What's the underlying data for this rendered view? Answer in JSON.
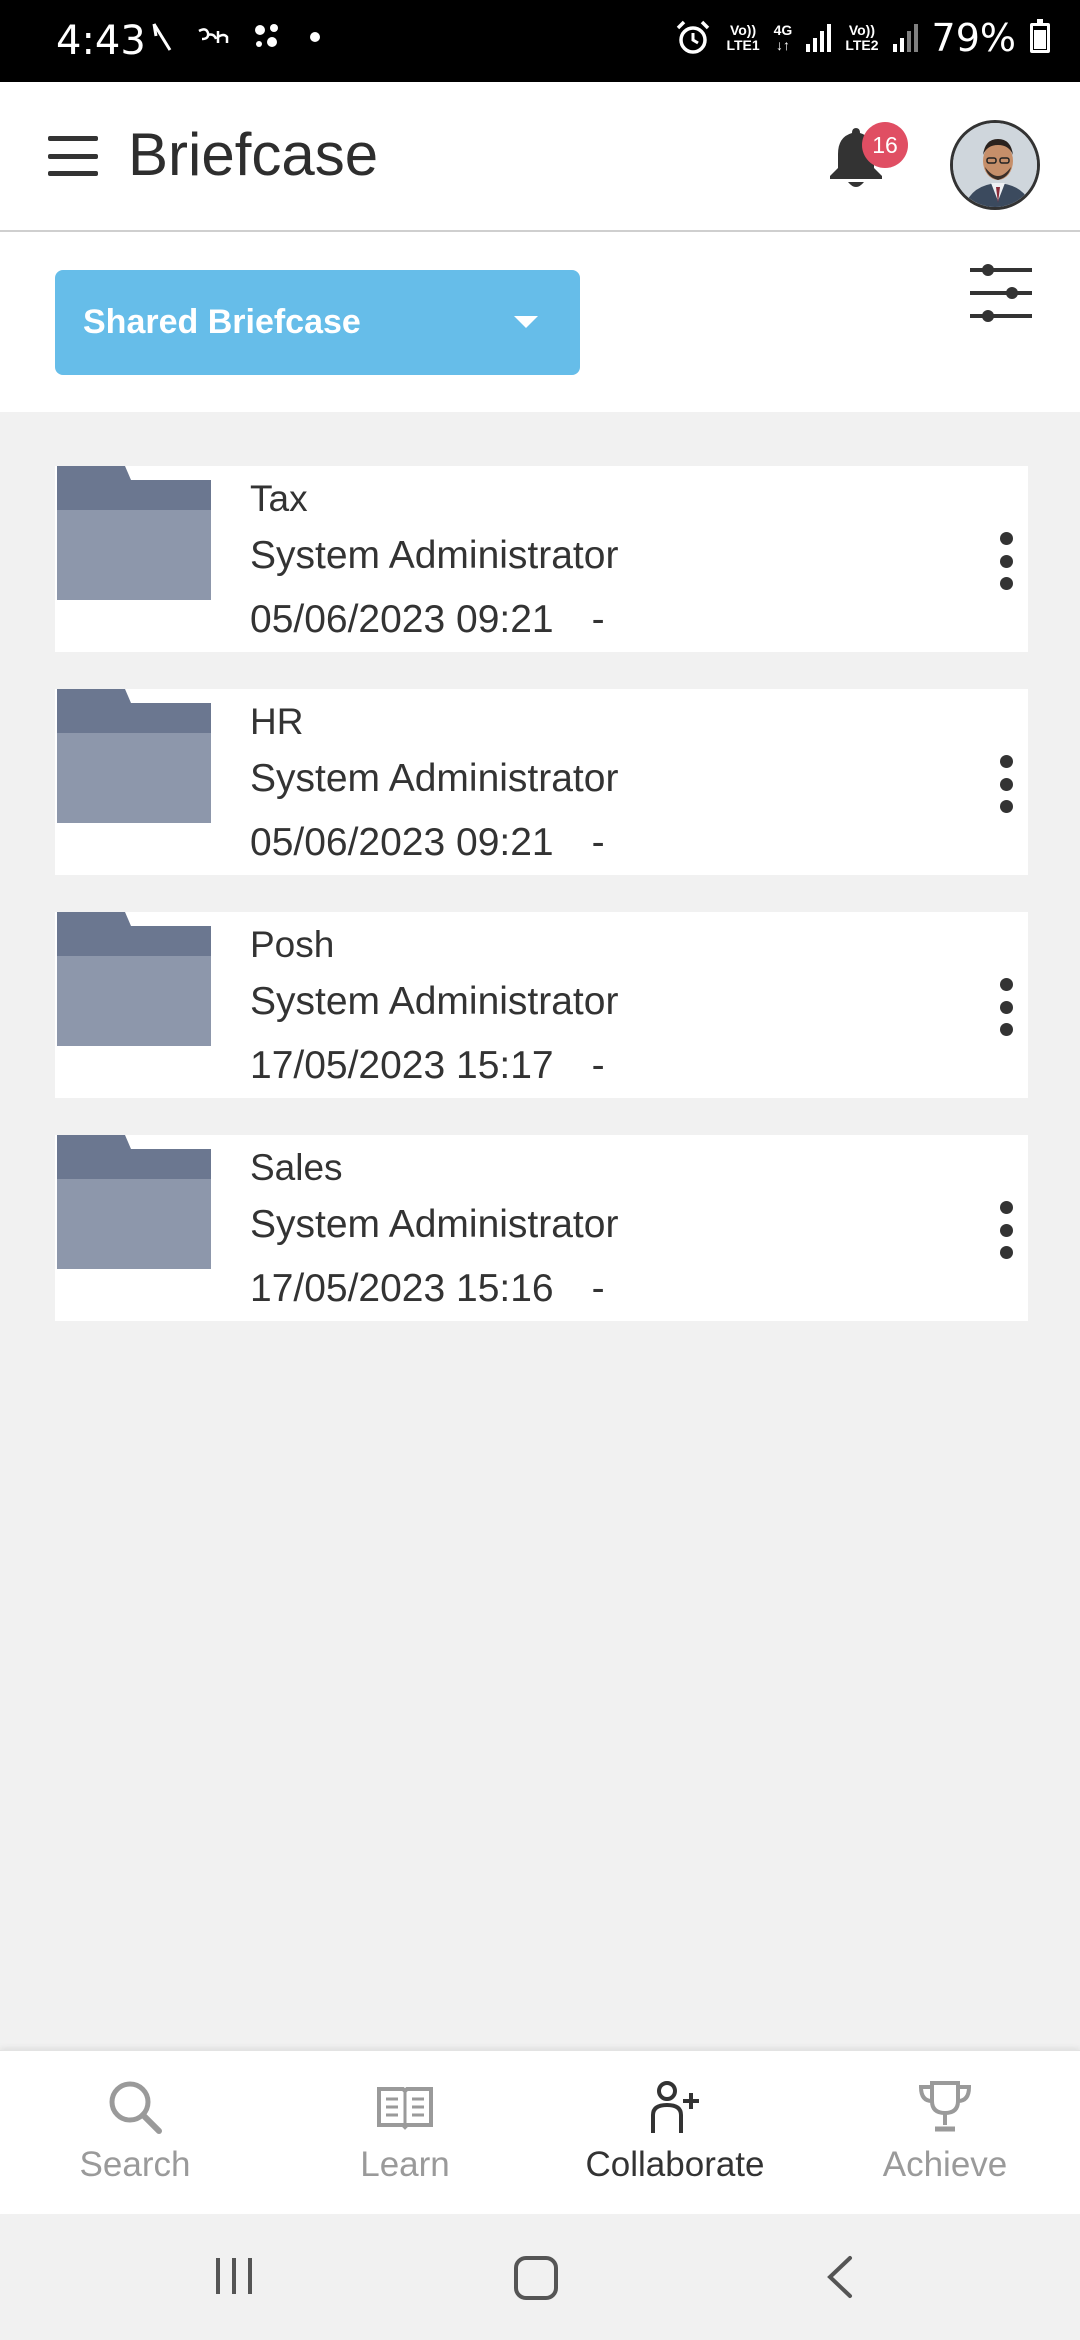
{
  "status_bar": {
    "time": "4:43",
    "left_icons": [
      "signal-slash-icon",
      "bn-icon",
      "assistant-dots-icon",
      "dot-icon"
    ],
    "sim1": {
      "top": "Vo))",
      "bottom": "LTE1"
    },
    "network": {
      "top": "4G",
      "bottom": "↓↑"
    },
    "sim2": {
      "top": "Vo))",
      "bottom": "LTE2"
    },
    "battery_percent": "79%"
  },
  "app_bar": {
    "title": "Briefcase",
    "notification_count": "16"
  },
  "filter": {
    "selected_briefcase": "Shared Briefcase"
  },
  "folders": [
    {
      "name": "Tax",
      "owner": "System Administrator",
      "date": "05/06/2023 09:21",
      "extra": "-"
    },
    {
      "name": "HR",
      "owner": "System Administrator",
      "date": "05/06/2023 09:21",
      "extra": "-"
    },
    {
      "name": "Posh",
      "owner": "System Administrator",
      "date": "17/05/2023 15:17",
      "extra": "-"
    },
    {
      "name": "Sales",
      "owner": "System Administrator",
      "date": "17/05/2023 15:16",
      "extra": "-"
    }
  ],
  "bottom_nav": {
    "items": [
      {
        "label": "Search",
        "icon": "search-icon",
        "active": false
      },
      {
        "label": "Learn",
        "icon": "book-icon",
        "active": false
      },
      {
        "label": "Collaborate",
        "icon": "add-person-icon",
        "active": true
      },
      {
        "label": "Achieve",
        "icon": "trophy-icon",
        "active": false
      }
    ]
  },
  "colors": {
    "accent": "#66bde9",
    "badge": "#e04e63",
    "folder_dark": "#6b7790",
    "folder_light": "#8d97ab",
    "background": "#f1f1f1"
  }
}
